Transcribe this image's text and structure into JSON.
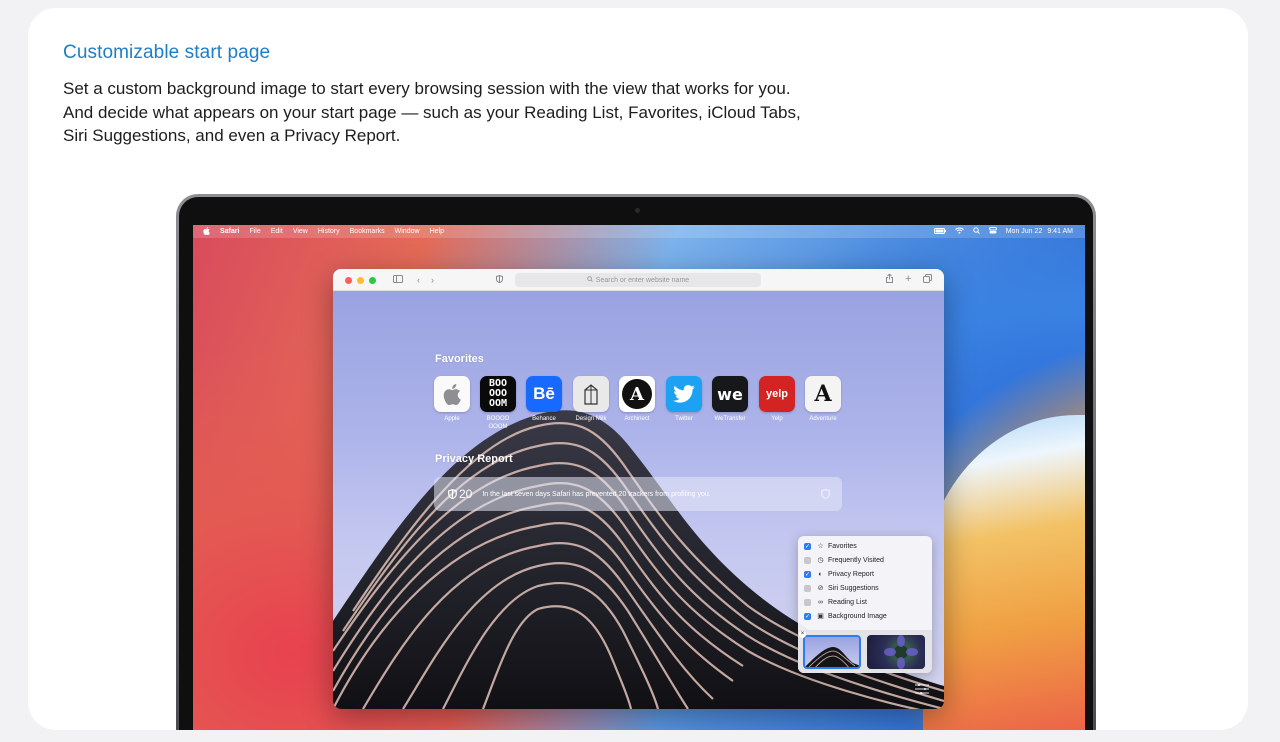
{
  "heading": "Customizable start page",
  "description": "Set a custom background image to start every browsing session with the view that works for you. And decide what appears on your start page — such as your Reading List, Favorites, iCloud Tabs, Siri Suggestions, and even a Privacy Report.",
  "menubar": {
    "app": "Safari",
    "items": [
      "File",
      "Edit",
      "View",
      "History",
      "Bookmarks",
      "Window",
      "Help"
    ],
    "date": "Mon Jun 22",
    "time": "9:41 AM"
  },
  "browser": {
    "url_placeholder": "Search or enter website name"
  },
  "favorites": {
    "title": "Favorites",
    "items": [
      {
        "label": "Apple",
        "icon": "apple-logo"
      },
      {
        "label": "BOOOO OOOM",
        "icon": "boooooom-logo"
      },
      {
        "label": "Behance",
        "icon": "behance-logo"
      },
      {
        "label": "Design Milk",
        "icon": "design-milk-logo"
      },
      {
        "label": "Archinect",
        "icon": "archinect-logo"
      },
      {
        "label": "Twitter",
        "icon": "twitter-logo"
      },
      {
        "label": "WeTransfer",
        "icon": "wetransfer-logo"
      },
      {
        "label": "Yelp",
        "icon": "yelp-logo"
      },
      {
        "label": "Adventure",
        "icon": "adventure-logo"
      }
    ],
    "tile_text": {
      "boooooom": "BOO OOO OOM",
      "behance": "Bē",
      "archinect": "A",
      "wetransfer": "we",
      "yelp": "yelp",
      "adventure": "A"
    }
  },
  "privacy": {
    "title": "Privacy Report",
    "count": "20",
    "message": "In the last seven days Safari has prevented 20 trackers from profiling you."
  },
  "customize_panel": {
    "options": [
      {
        "label": "Favorites",
        "checked": true,
        "icon": "star-icon"
      },
      {
        "label": "Frequently Visited",
        "checked": false,
        "icon": "clock-icon"
      },
      {
        "label": "Privacy Report",
        "checked": true,
        "icon": "shield-icon"
      },
      {
        "label": "Siri Suggestions",
        "checked": false,
        "icon": "siri-icon"
      },
      {
        "label": "Reading List",
        "checked": false,
        "icon": "glasses-icon"
      },
      {
        "label": "Background Image",
        "checked": true,
        "icon": "image-icon"
      }
    ]
  },
  "colors": {
    "heading_blue": "#1d7ec8",
    "checkbox_blue": "#2d7cf6"
  }
}
